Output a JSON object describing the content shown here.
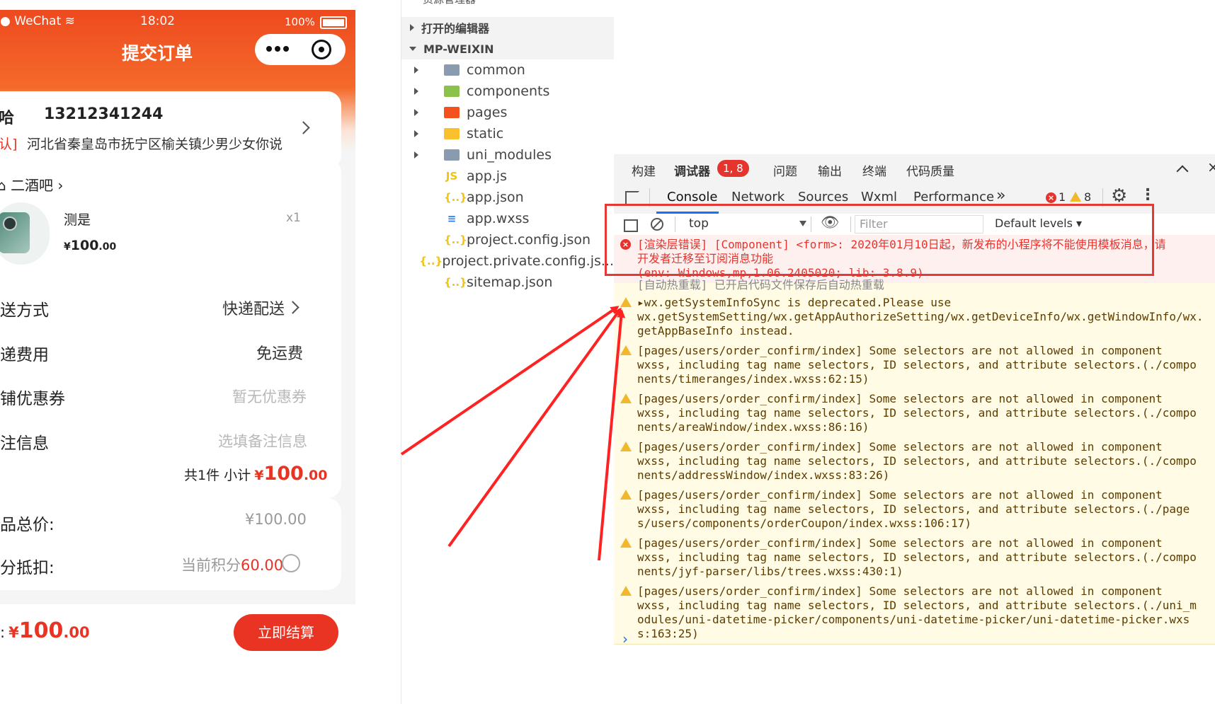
{
  "phone": {
    "status": {
      "carrier": "WeChat",
      "time": "18:02",
      "battery": "100%"
    },
    "title": "提交订单",
    "address": {
      "name": "哈",
      "phone": "13212341244",
      "tag": "认]",
      "detail": "河北省秦皇岛市抚宁区榆关镇少男少女你说"
    },
    "shop": {
      "name": "二酒吧"
    },
    "product": {
      "name": "测是",
      "qty": "x1",
      "price_sym": "¥",
      "price_int": "100",
      "price_dec": ".00"
    },
    "rows": [
      {
        "label": "送方式",
        "value": "快递配送"
      },
      {
        "label": "递费用",
        "value": "免运费"
      },
      {
        "label": "铺优惠券",
        "value": "暂无优惠券"
      },
      {
        "label": "注信息",
        "value": "选填备注信息"
      }
    ],
    "subtotal": {
      "prefix": "共1件 小计",
      "sym": "¥",
      "int": "100",
      "dec": ".00"
    },
    "summary": {
      "total_label": "品总价:",
      "total_value": "¥100.00",
      "points_label": "分抵扣:",
      "points_prefix": "当前积分",
      "points_value": "60.00"
    },
    "footer": {
      "label": ":",
      "sym": "¥",
      "int": "100",
      "dec": ".00",
      "button": "立即结算"
    }
  },
  "explorer": {
    "top_cut": "资源管理器",
    "sections": [
      "打开的编辑器",
      "MP-WEIXIN"
    ],
    "items": [
      {
        "name": "common",
        "icon": "folder-icon",
        "color": "#8a9bb0",
        "expandable": true
      },
      {
        "name": "components",
        "icon": "folder-components-icon",
        "color": "#8bc34a",
        "expandable": true
      },
      {
        "name": "pages",
        "icon": "folder-pages-icon",
        "color": "#f4511e",
        "expandable": true
      },
      {
        "name": "static",
        "icon": "folder-static-icon",
        "color": "#fbc02d",
        "expandable": true
      },
      {
        "name": "uni_modules",
        "icon": "folder-icon",
        "color": "#8a9bb0",
        "expandable": true
      },
      {
        "name": "app.js",
        "icon": "js-file-icon",
        "color": "#f1c40f",
        "expandable": false,
        "glyph": "JS"
      },
      {
        "name": "app.json",
        "icon": "json-file-icon",
        "color": "#f1c40f",
        "expandable": false,
        "glyph": "{..}"
      },
      {
        "name": "app.wxss",
        "icon": "css-file-icon",
        "color": "#2b7de9",
        "expandable": false,
        "glyph": "≡"
      },
      {
        "name": "project.config.json",
        "icon": "json-file-icon",
        "color": "#f1c40f",
        "expandable": false,
        "glyph": "{..}"
      },
      {
        "name": "project.private.config.js...",
        "icon": "json-file-icon",
        "color": "#f1c40f",
        "expandable": false,
        "glyph": "{..}"
      },
      {
        "name": "sitemap.json",
        "icon": "json-file-icon",
        "color": "#f1c40f",
        "expandable": false,
        "glyph": "{..}"
      }
    ]
  },
  "devtools": {
    "top_tabs": [
      "构建",
      "调试器",
      "问题",
      "输出",
      "终端",
      "代码质量"
    ],
    "debugger_badge": "1, 8",
    "tabs": [
      "Console",
      "Network",
      "Sources",
      "Wxml",
      "Performance"
    ],
    "more": "»",
    "error_count": "1",
    "warn_count": "8",
    "context": "top",
    "filter_placeholder": "Filter",
    "levels": "Default levels",
    "messages": [
      {
        "type": "error",
        "lines": [
          "[渲染层错误] [Component] <form>: 2020年01月10日起，新发布的小程序将不能使用模板消息，请",
          "开发者迁移至订阅消息功能",
          "(env: Windows,mp,1.06.2405020; lib: 3.8.9)"
        ]
      },
      {
        "type": "info",
        "lines": [
          "[自动热重载] 已开启代码文件保存后自动热重载"
        ]
      },
      {
        "type": "warn",
        "lines": [
          "▸wx.getSystemInfoSync is deprecated.Please use",
          "wx.getSystemSetting/wx.getAppAuthorizeSetting/wx.getDeviceInfo/wx.getWindowInfo/wx.",
          "getAppBaseInfo instead."
        ]
      },
      {
        "type": "warn",
        "lines": [
          "[pages/users/order_confirm/index] Some selectors are not allowed in component",
          "wxss, including tag name selectors, ID selectors, and attribute selectors.(./compo",
          "nents/timeranges/index.wxss:62:15)"
        ]
      },
      {
        "type": "warn",
        "lines": [
          "[pages/users/order_confirm/index] Some selectors are not allowed in component",
          "wxss, including tag name selectors, ID selectors, and attribute selectors.(./compo",
          "nents/areaWindow/index.wxss:86:16)"
        ]
      },
      {
        "type": "warn",
        "lines": [
          "[pages/users/order_confirm/index] Some selectors are not allowed in component",
          "wxss, including tag name selectors, ID selectors, and attribute selectors.(./compo",
          "nents/addressWindow/index.wxss:83:26)"
        ]
      },
      {
        "type": "warn",
        "lines": [
          "[pages/users/order_confirm/index] Some selectors are not allowed in component",
          "wxss, including tag name selectors, ID selectors, and attribute selectors.(./page",
          "s/users/components/orderCoupon/index.wxss:106:17)"
        ]
      },
      {
        "type": "warn",
        "lines": [
          "[pages/users/order_confirm/index] Some selectors are not allowed in component",
          "wxss, including tag name selectors, ID selectors, and attribute selectors.(./compo",
          "nents/jyf-parser/libs/trees.wxss:430:1)"
        ]
      },
      {
        "type": "warn",
        "lines": [
          "[pages/users/order_confirm/index] Some selectors are not allowed in component",
          "wxss, including tag name selectors, ID selectors, and attribute selectors.(./uni_m",
          "odules/uni-datetime-picker/components/uni-datetime-picker/uni-datetime-picker.wxs",
          "s:163:25)"
        ]
      }
    ],
    "prompt": "›"
  },
  "colors": {
    "accent": "#e93323",
    "error": "#e5342d",
    "warn": "#f1b82d",
    "highlight_box": "#e53935"
  }
}
